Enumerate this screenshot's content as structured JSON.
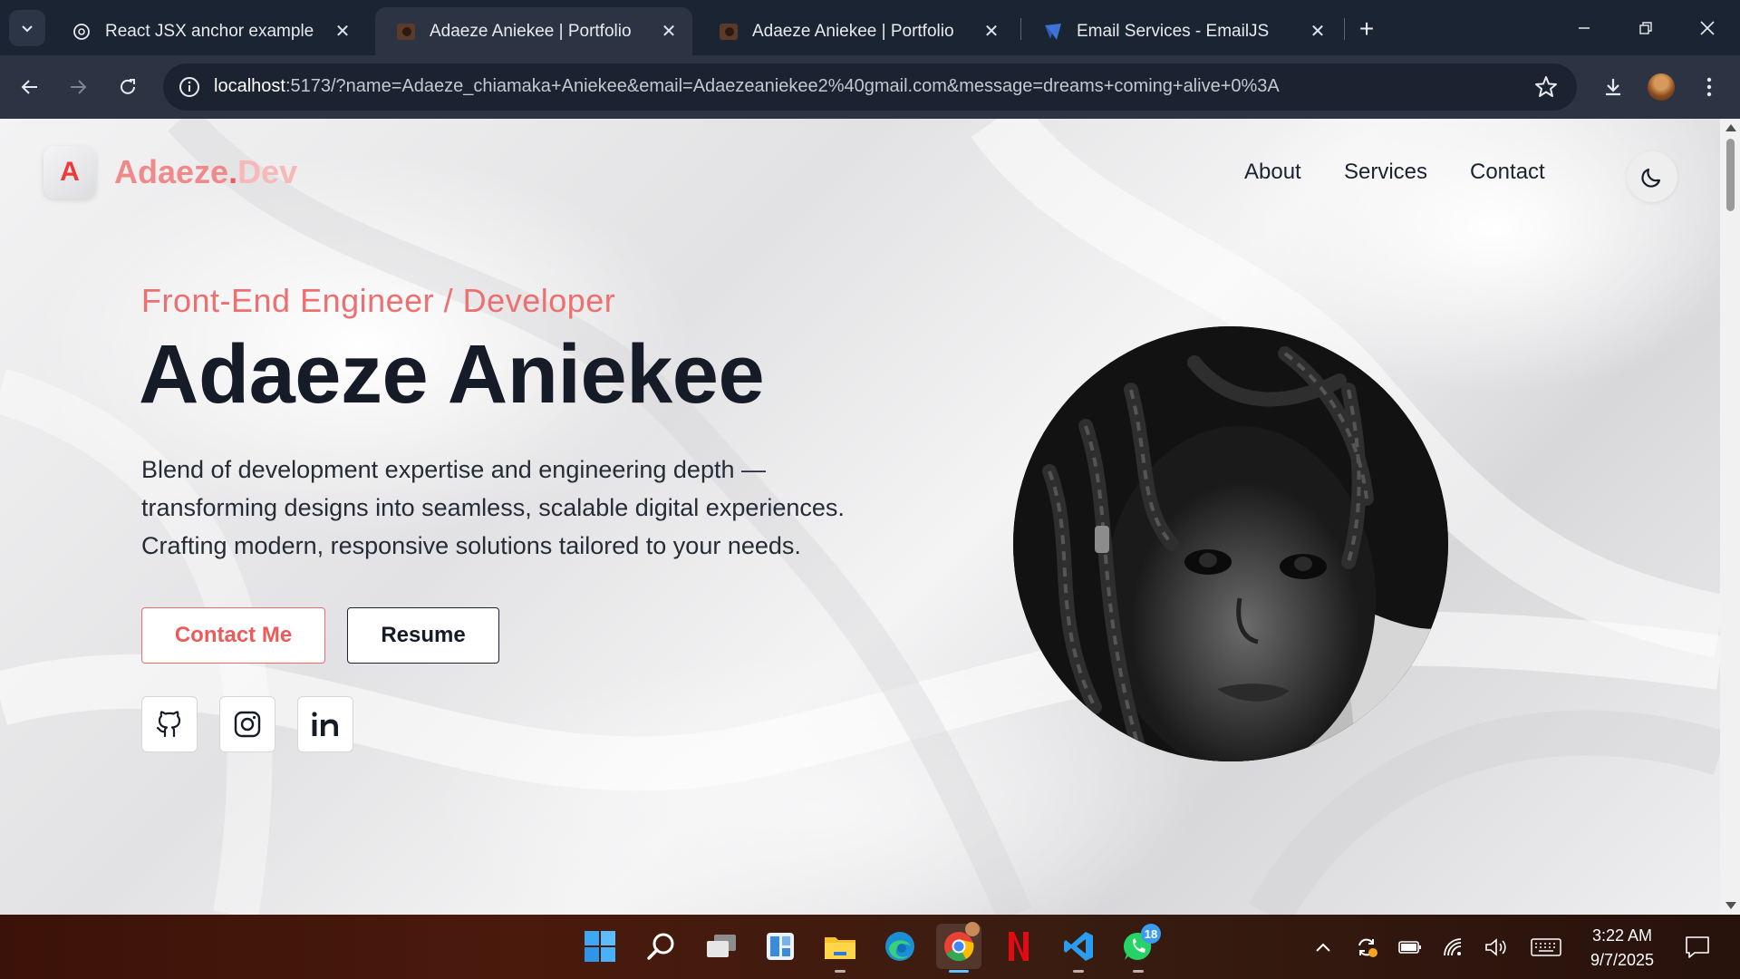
{
  "browser": {
    "tabs": [
      {
        "title": "React JSX anchor example",
        "active": false,
        "icon": "openai-icon"
      },
      {
        "title": "Adaeze Aniekee | Portfolio",
        "active": true,
        "icon": "portfolio-favicon"
      },
      {
        "title": "Adaeze Aniekee | Portfolio",
        "active": false,
        "icon": "portfolio-favicon"
      },
      {
        "title": "Email Services - EmailJS",
        "active": false,
        "icon": "emailjs-icon"
      }
    ],
    "url_host": "localhost",
    "url_rest": ":5173/?name=Adaeze_chiamaka+Aniekee&email=Adaezeaniekee2%40gmail.com&message=dreams+coming+alive+0%3A"
  },
  "site": {
    "logo_letter": "A",
    "logo_text_a": "Adaeze",
    "logo_text_dot": ".",
    "logo_text_b": "Dev",
    "nav": [
      "About",
      "Services",
      "Contact"
    ],
    "theme_icon": "moon-icon"
  },
  "hero": {
    "role": "Front-End Engineer / Developer",
    "name": "Adaeze Aniekee",
    "bio_lines": [
      "Blend of development expertise and engineering depth —",
      "transforming designs into seamless, scalable digital experiences.",
      "Crafting modern, responsive solutions tailored to your needs."
    ],
    "contact_button": "Contact Me",
    "resume_button": "Resume",
    "socials": [
      "github-icon",
      "instagram-icon",
      "linkedin-icon"
    ]
  },
  "taskbar": {
    "apps": [
      "windows-start-icon",
      "search-icon",
      "task-view-icon",
      "widgets-icon",
      "file-explorer-icon",
      "edge-icon",
      "chrome-icon",
      "netflix-icon",
      "vscode-icon",
      "whatsapp-icon"
    ],
    "whatsapp_badge": "18",
    "time": "3:22 AM",
    "date": "9/7/2025"
  },
  "colors": {
    "accent": "#ec5b5b",
    "dark_text": "#151b27",
    "chrome_bg": "#1b2433"
  }
}
